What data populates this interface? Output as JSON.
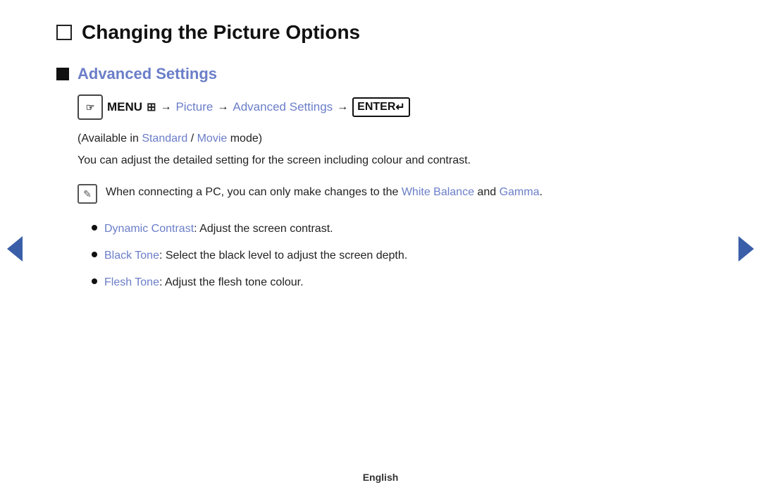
{
  "page": {
    "title": "Changing the Picture Options",
    "section": {
      "title": "Advanced Settings",
      "menu_path": {
        "menu_label": "MENU",
        "arrow1": "→",
        "picture_link": "Picture",
        "arrow2": "→",
        "advanced_settings_link": "Advanced Settings",
        "arrow3": "→",
        "enter_label": "ENTER"
      },
      "available_text_before": "(Available in ",
      "standard_link": "Standard",
      "available_text_slash": " / ",
      "movie_link": "Movie",
      "available_text_after": " mode)",
      "description": "You can adjust the detailed setting for the screen including colour and contrast.",
      "note": {
        "text_before": "When connecting a PC, you can only make changes to the ",
        "white_balance_link": "White Balance",
        "text_middle": " and ",
        "gamma_link": "Gamma",
        "text_after": "."
      },
      "bullets": [
        {
          "link": "Dynamic Contrast",
          "text": ": Adjust the screen contrast."
        },
        {
          "link": "Black Tone",
          "text": ": Select the black level to adjust the screen depth."
        },
        {
          "link": "Flesh Tone",
          "text": ": Adjust the flesh tone colour."
        }
      ]
    },
    "footer": {
      "language": "English"
    }
  },
  "colors": {
    "link": "#6b7ec8",
    "nav_arrow": "#3a5fa8",
    "text": "#222222",
    "title": "#111111"
  }
}
